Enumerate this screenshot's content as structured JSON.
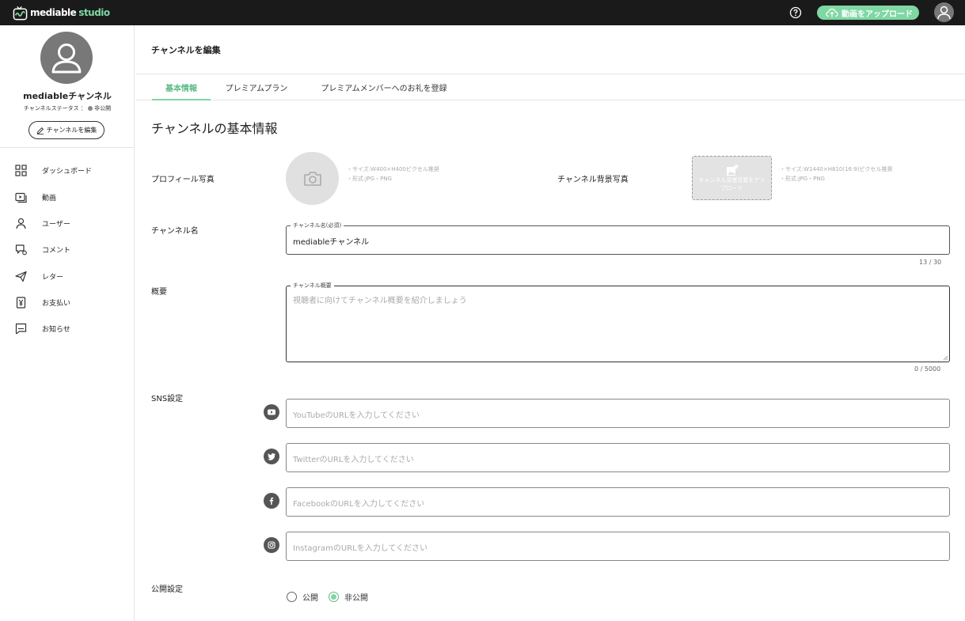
{
  "app": {
    "logo_text": "mediable",
    "logo_suffix": "studio",
    "upload_button": "動画をアップロード"
  },
  "sidebar": {
    "channel_name": "mediableチャンネル",
    "status_label": "チャンネルステータス ：",
    "status_value": "非公開",
    "edit_button": "チャンネルを編集",
    "nav": [
      {
        "label": "ダッシュボード",
        "icon": "dashboard-icon"
      },
      {
        "label": "動画",
        "icon": "video-icon"
      },
      {
        "label": "ユーザー",
        "icon": "user-icon"
      },
      {
        "label": "コメント",
        "icon": "comment-icon"
      },
      {
        "label": "レター",
        "icon": "letter-icon"
      },
      {
        "label": "お支払い",
        "icon": "payment-icon"
      },
      {
        "label": "お知らせ",
        "icon": "notice-icon"
      }
    ]
  },
  "header": {
    "page_title": "チャンネルを編集",
    "tabs": [
      {
        "label": "基本情報",
        "active": true
      },
      {
        "label": "プレミアムプラン",
        "active": false
      },
      {
        "label": "プレミアムメンバーへのお礼を登録",
        "active": false
      }
    ]
  },
  "form": {
    "section_title": "チャンネルの基本情報",
    "profile_photo_label": "プロフィール写真",
    "profile_hint_size": "・サイズ:W400×H400ピクセル推奨",
    "profile_hint_format": "・形式:JPG・PNG",
    "bg_photo_label": "チャンネル背景写真",
    "bg_upload_text": "チャンネル背景写真をアップロード",
    "bg_hint_size": "・サイズ:W1440×H810(16:9)ピクセル推奨",
    "bg_hint_format": "・形式:JPG・PNG",
    "channel_name_label": "チャンネル名",
    "channel_name_field_label": "チャンネル名(必須)",
    "channel_name_value": "mediableチャンネル",
    "channel_name_counter": "13 / 30",
    "summary_label": "概要",
    "summary_field_label": "チャンネル概要",
    "summary_placeholder": "視聴者に向けてチャンネル概要を紹介しましょう",
    "summary_counter": "0 / 5000",
    "sns_label": "SNS設定",
    "sns": [
      {
        "icon": "youtube-icon",
        "placeholder": "YouTubeのURLを入力してください"
      },
      {
        "icon": "twitter-icon",
        "placeholder": "TwitterのURLを入力してください"
      },
      {
        "icon": "facebook-icon",
        "placeholder": "FacebookのURLを入力してください"
      },
      {
        "icon": "instagram-icon",
        "placeholder": "InstagramのURLを入力してください"
      }
    ],
    "visibility_label": "公開設定",
    "visibility_options": [
      {
        "label": "公開",
        "selected": false
      },
      {
        "label": "非公開",
        "selected": true
      }
    ]
  },
  "colors": {
    "accent": "#7fd7a3",
    "topbar": "#1a1a1a"
  }
}
